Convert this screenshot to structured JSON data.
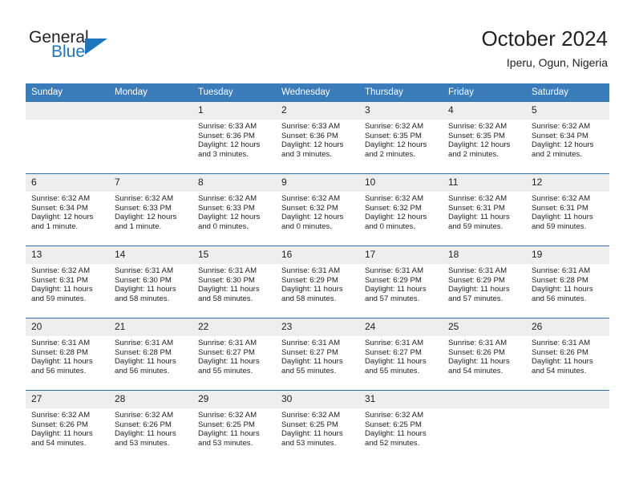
{
  "brand": {
    "name_part1": "General",
    "name_part2": "Blue",
    "logo_icon": "triangle-logo-icon"
  },
  "header": {
    "title": "October 2024",
    "subtitle": "Iperu, Ogun, Nigeria"
  },
  "theme": {
    "header_blue": "#3a7cba",
    "separator_blue": "#2e6fae",
    "daynum_band": "#eeeeee",
    "brand_blue": "#1d76bc",
    "text": "#222222"
  },
  "weekdays": [
    "Sunday",
    "Monday",
    "Tuesday",
    "Wednesday",
    "Thursday",
    "Friday",
    "Saturday"
  ],
  "weeks": [
    [
      {
        "day": "",
        "sunrise": "",
        "sunset": "",
        "daylight": "",
        "empty": true
      },
      {
        "day": "",
        "sunrise": "",
        "sunset": "",
        "daylight": "",
        "empty": true
      },
      {
        "day": "1",
        "sunrise": "Sunrise: 6:33 AM",
        "sunset": "Sunset: 6:36 PM",
        "daylight": "Daylight: 12 hours and 3 minutes.",
        "empty": false
      },
      {
        "day": "2",
        "sunrise": "Sunrise: 6:33 AM",
        "sunset": "Sunset: 6:36 PM",
        "daylight": "Daylight: 12 hours and 3 minutes.",
        "empty": false
      },
      {
        "day": "3",
        "sunrise": "Sunrise: 6:32 AM",
        "sunset": "Sunset: 6:35 PM",
        "daylight": "Daylight: 12 hours and 2 minutes.",
        "empty": false
      },
      {
        "day": "4",
        "sunrise": "Sunrise: 6:32 AM",
        "sunset": "Sunset: 6:35 PM",
        "daylight": "Daylight: 12 hours and 2 minutes.",
        "empty": false
      },
      {
        "day": "5",
        "sunrise": "Sunrise: 6:32 AM",
        "sunset": "Sunset: 6:34 PM",
        "daylight": "Daylight: 12 hours and 2 minutes.",
        "empty": false
      }
    ],
    [
      {
        "day": "6",
        "sunrise": "Sunrise: 6:32 AM",
        "sunset": "Sunset: 6:34 PM",
        "daylight": "Daylight: 12 hours and 1 minute.",
        "empty": false
      },
      {
        "day": "7",
        "sunrise": "Sunrise: 6:32 AM",
        "sunset": "Sunset: 6:33 PM",
        "daylight": "Daylight: 12 hours and 1 minute.",
        "empty": false
      },
      {
        "day": "8",
        "sunrise": "Sunrise: 6:32 AM",
        "sunset": "Sunset: 6:33 PM",
        "daylight": "Daylight: 12 hours and 0 minutes.",
        "empty": false
      },
      {
        "day": "9",
        "sunrise": "Sunrise: 6:32 AM",
        "sunset": "Sunset: 6:32 PM",
        "daylight": "Daylight: 12 hours and 0 minutes.",
        "empty": false
      },
      {
        "day": "10",
        "sunrise": "Sunrise: 6:32 AM",
        "sunset": "Sunset: 6:32 PM",
        "daylight": "Daylight: 12 hours and 0 minutes.",
        "empty": false
      },
      {
        "day": "11",
        "sunrise": "Sunrise: 6:32 AM",
        "sunset": "Sunset: 6:31 PM",
        "daylight": "Daylight: 11 hours and 59 minutes.",
        "empty": false
      },
      {
        "day": "12",
        "sunrise": "Sunrise: 6:32 AM",
        "sunset": "Sunset: 6:31 PM",
        "daylight": "Daylight: 11 hours and 59 minutes.",
        "empty": false
      }
    ],
    [
      {
        "day": "13",
        "sunrise": "Sunrise: 6:32 AM",
        "sunset": "Sunset: 6:31 PM",
        "daylight": "Daylight: 11 hours and 59 minutes.",
        "empty": false
      },
      {
        "day": "14",
        "sunrise": "Sunrise: 6:31 AM",
        "sunset": "Sunset: 6:30 PM",
        "daylight": "Daylight: 11 hours and 58 minutes.",
        "empty": false
      },
      {
        "day": "15",
        "sunrise": "Sunrise: 6:31 AM",
        "sunset": "Sunset: 6:30 PM",
        "daylight": "Daylight: 11 hours and 58 minutes.",
        "empty": false
      },
      {
        "day": "16",
        "sunrise": "Sunrise: 6:31 AM",
        "sunset": "Sunset: 6:29 PM",
        "daylight": "Daylight: 11 hours and 58 minutes.",
        "empty": false
      },
      {
        "day": "17",
        "sunrise": "Sunrise: 6:31 AM",
        "sunset": "Sunset: 6:29 PM",
        "daylight": "Daylight: 11 hours and 57 minutes.",
        "empty": false
      },
      {
        "day": "18",
        "sunrise": "Sunrise: 6:31 AM",
        "sunset": "Sunset: 6:29 PM",
        "daylight": "Daylight: 11 hours and 57 minutes.",
        "empty": false
      },
      {
        "day": "19",
        "sunrise": "Sunrise: 6:31 AM",
        "sunset": "Sunset: 6:28 PM",
        "daylight": "Daylight: 11 hours and 56 minutes.",
        "empty": false
      }
    ],
    [
      {
        "day": "20",
        "sunrise": "Sunrise: 6:31 AM",
        "sunset": "Sunset: 6:28 PM",
        "daylight": "Daylight: 11 hours and 56 minutes.",
        "empty": false
      },
      {
        "day": "21",
        "sunrise": "Sunrise: 6:31 AM",
        "sunset": "Sunset: 6:28 PM",
        "daylight": "Daylight: 11 hours and 56 minutes.",
        "empty": false
      },
      {
        "day": "22",
        "sunrise": "Sunrise: 6:31 AM",
        "sunset": "Sunset: 6:27 PM",
        "daylight": "Daylight: 11 hours and 55 minutes.",
        "empty": false
      },
      {
        "day": "23",
        "sunrise": "Sunrise: 6:31 AM",
        "sunset": "Sunset: 6:27 PM",
        "daylight": "Daylight: 11 hours and 55 minutes.",
        "empty": false
      },
      {
        "day": "24",
        "sunrise": "Sunrise: 6:31 AM",
        "sunset": "Sunset: 6:27 PM",
        "daylight": "Daylight: 11 hours and 55 minutes.",
        "empty": false
      },
      {
        "day": "25",
        "sunrise": "Sunrise: 6:31 AM",
        "sunset": "Sunset: 6:26 PM",
        "daylight": "Daylight: 11 hours and 54 minutes.",
        "empty": false
      },
      {
        "day": "26",
        "sunrise": "Sunrise: 6:31 AM",
        "sunset": "Sunset: 6:26 PM",
        "daylight": "Daylight: 11 hours and 54 minutes.",
        "empty": false
      }
    ],
    [
      {
        "day": "27",
        "sunrise": "Sunrise: 6:32 AM",
        "sunset": "Sunset: 6:26 PM",
        "daylight": "Daylight: 11 hours and 54 minutes.",
        "empty": false
      },
      {
        "day": "28",
        "sunrise": "Sunrise: 6:32 AM",
        "sunset": "Sunset: 6:26 PM",
        "daylight": "Daylight: 11 hours and 53 minutes.",
        "empty": false
      },
      {
        "day": "29",
        "sunrise": "Sunrise: 6:32 AM",
        "sunset": "Sunset: 6:25 PM",
        "daylight": "Daylight: 11 hours and 53 minutes.",
        "empty": false
      },
      {
        "day": "30",
        "sunrise": "Sunrise: 6:32 AM",
        "sunset": "Sunset: 6:25 PM",
        "daylight": "Daylight: 11 hours and 53 minutes.",
        "empty": false
      },
      {
        "day": "31",
        "sunrise": "Sunrise: 6:32 AM",
        "sunset": "Sunset: 6:25 PM",
        "daylight": "Daylight: 11 hours and 52 minutes.",
        "empty": false
      },
      {
        "day": "",
        "sunrise": "",
        "sunset": "",
        "daylight": "",
        "empty": true
      },
      {
        "day": "",
        "sunrise": "",
        "sunset": "",
        "daylight": "",
        "empty": true
      }
    ]
  ]
}
